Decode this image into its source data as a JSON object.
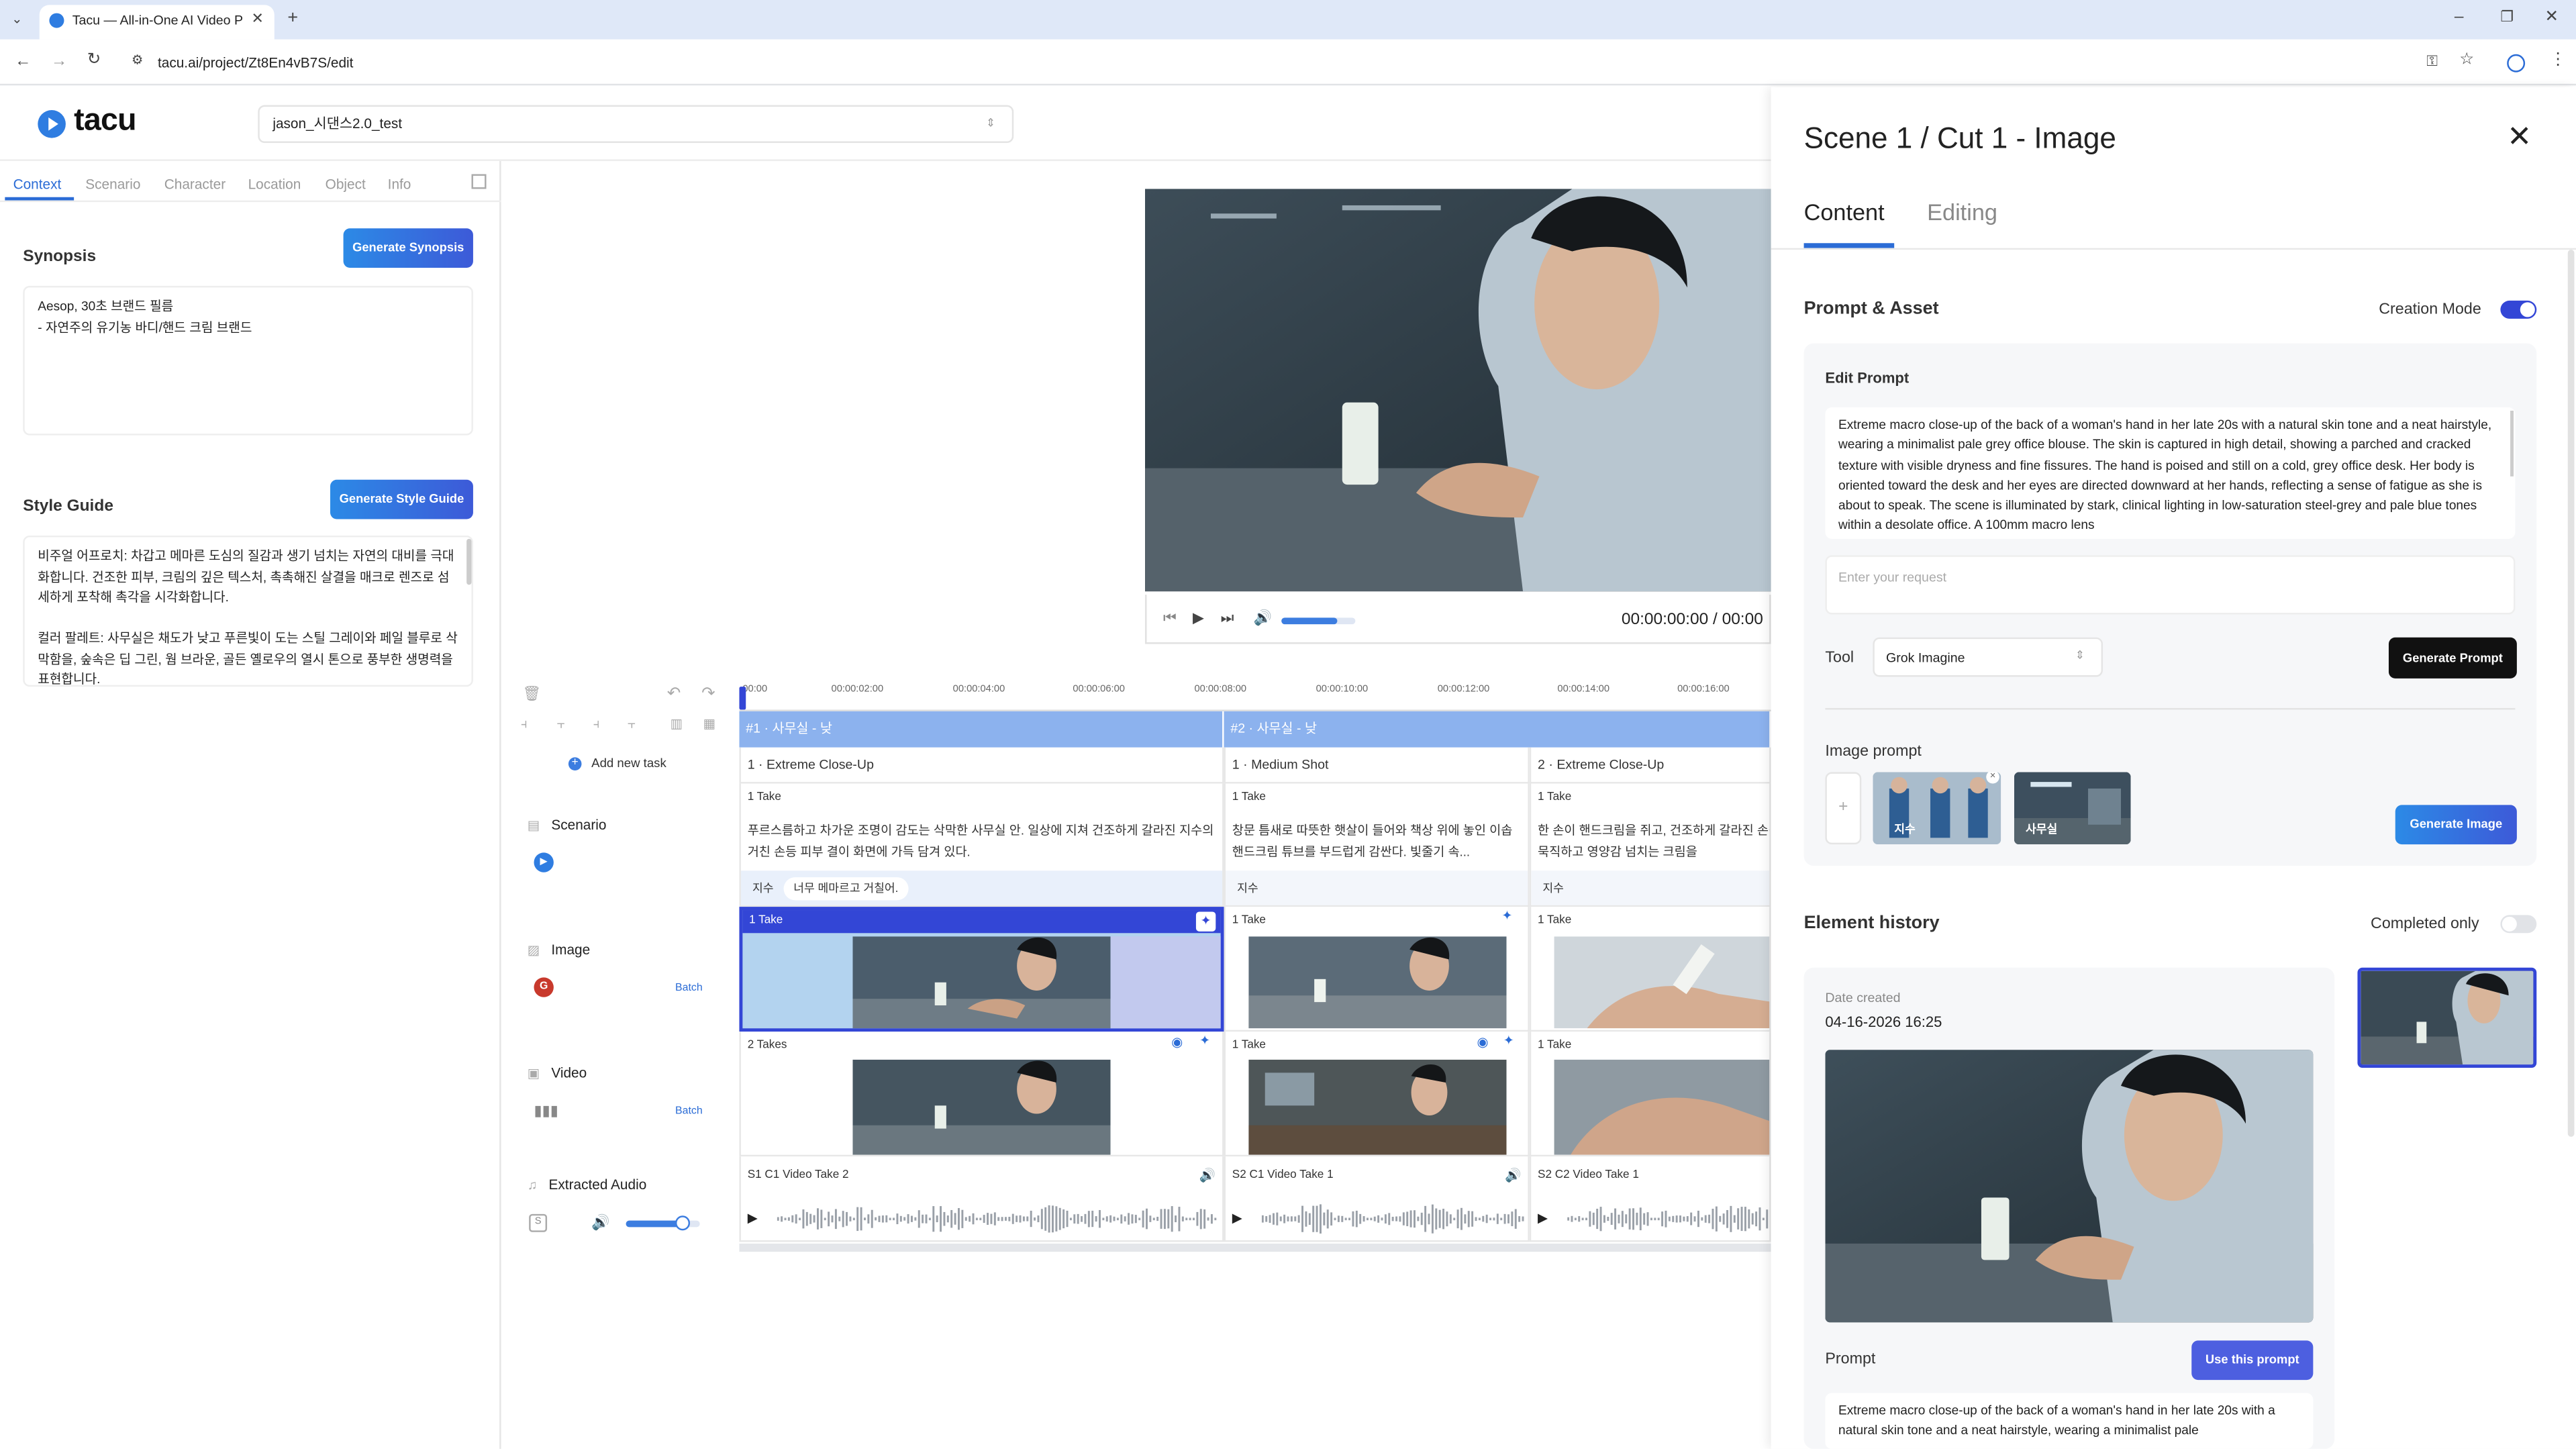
{
  "browser": {
    "tab_title": "Tacu — All-in-One AI Video P",
    "url": "tacu.ai/project/Zt8En4vB7S/edit"
  },
  "app": {
    "logo_text": "tacu",
    "project_name": "jason_시댄스2.0_test"
  },
  "left_tabs": [
    "Context",
    "Scenario",
    "Character",
    "Location",
    "Object",
    "Info"
  ],
  "synopsis": {
    "title": "Synopsis",
    "button": "Generate Synopsis",
    "text": "Aesop, 30초 브랜드 필름\n- 자연주의 유기농 바디/핸드 크림 브랜드"
  },
  "style_guide": {
    "title": "Style Guide",
    "button": "Generate Style Guide",
    "text": "비주얼 어프로치: 차갑고 메마른 도심의 질감과 생기 넘치는 자연의 대비를 극대화합니다. 건조한 피부, 크림의 깊은 텍스처, 촉촉해진 살결을 매크로 렌즈로 섬세하게 포착해 촉각을 시각화합니다.\n\n컬러 팔레트: 사무실은 채도가 낮고 푸른빛이 도는 스틸 그레이와 페일 블루로 삭막함을, 숲속은 딥 그린, 웜 브라운, 골든 옐로우의 열시 톤으로 풍부한 생명력을 표현합니다."
  },
  "player": {
    "time": "00:00:00:00 / 00:00",
    "volume": 0.75
  },
  "timeline": {
    "ruler": [
      "00:00",
      "00:00:02:00",
      "00:00:04:00",
      "00:00:06:00",
      "00:00:08:00",
      "00:00:10:00",
      "00:00:12:00",
      "00:00:14:00",
      "00:00:16:00"
    ],
    "add_task": "Add new task",
    "tracks": {
      "scenario": "Scenario",
      "image": "Image",
      "video": "Video",
      "audio": "Extracted Audio",
      "batch": "Batch",
      "image_badge": "G"
    },
    "scenes": [
      {
        "label": "#1 · 사무실 - 낮"
      },
      {
        "label": "#2 · 사무실 - 낮"
      }
    ],
    "shots": [
      {
        "label": "1 · Extreme Close-Up",
        "scenario_take": "1 Take",
        "text": "푸르스름하고 차가운 조명이 감도는 삭막한 사무실 안. 일상에 지쳐 건조하게 갈라진 지수의 거친 손등 피부 결이 화면에 가득 담겨 있다.",
        "character": "지수",
        "dialogue": "너무 메마르고 거칠어.",
        "image_take": "1 Take",
        "video_take": "2 Takes",
        "audio": "S1 C1 Video Take 2"
      },
      {
        "label": "1 · Medium Shot",
        "scenario_take": "1 Take",
        "text": "창문 틈새로 따뜻한 햇살이 들어와 책상 위에 놓인 이솝 핸드크림 튜브를 부드럽게 감싼다. 빛줄기 속...",
        "character": "지수",
        "dialogue": "",
        "image_take": "1 Take",
        "video_take": "1 Take",
        "audio": "S2 C1 Video Take 1"
      },
      {
        "label": "2 · Extreme Close-Up",
        "scenario_take": "1 Take",
        "text": "한 손이 핸드크림을 쥐고, 건조하게 갈라진 손등 위로 묵직하고 영양감 넘치는 크림을",
        "character": "지수",
        "dialogue": "",
        "image_take": "1 Take",
        "video_take": "1 Take",
        "audio": "S2 C2 Video Take 1"
      }
    ]
  },
  "right_panel": {
    "title": "Scene 1 / Cut 1 - Image",
    "tabs": [
      "Content",
      "Editing"
    ],
    "prompt_asset": "Prompt & Asset",
    "creation_mode": "Creation Mode",
    "edit_prompt_label": "Edit Prompt",
    "prompt_text": "Extreme macro close-up of the back of a woman's hand in her late 20s with a natural skin tone and a neat hairstyle, wearing a minimalist pale grey office blouse. The skin is captured in high detail, showing a parched and cracked texture with visible dryness and fine fissures. The hand is poised and still on a cold, grey office desk. Her body is oriented toward the desk and her eyes are directed downward at her hands, reflecting a sense of fatigue as she is about to speak. The scene is illuminated by stark, clinical lighting in low-saturation steel-grey and pale blue tones within a desolate office. A 100mm macro lens",
    "request_placeholder": "Enter your request",
    "tool_label": "Tool",
    "tool_value": "Grok Imagine",
    "generate_prompt": "Generate Prompt",
    "image_prompt_label": "Image prompt",
    "add_symbol": "+",
    "refs": [
      "지수",
      "사무실"
    ],
    "generate_image": "Generate Image",
    "element_history": "Element history",
    "completed_only": "Completed only",
    "date_created_label": "Date created",
    "date_created": "04-16-2026 16:25",
    "prompt_label": "Prompt",
    "use_prompt": "Use this prompt",
    "prompt_preview": "Extreme macro close-up of the back of a woman's hand in her late 20s with a natural skin tone and a neat hairstyle, wearing a minimalist pale"
  }
}
